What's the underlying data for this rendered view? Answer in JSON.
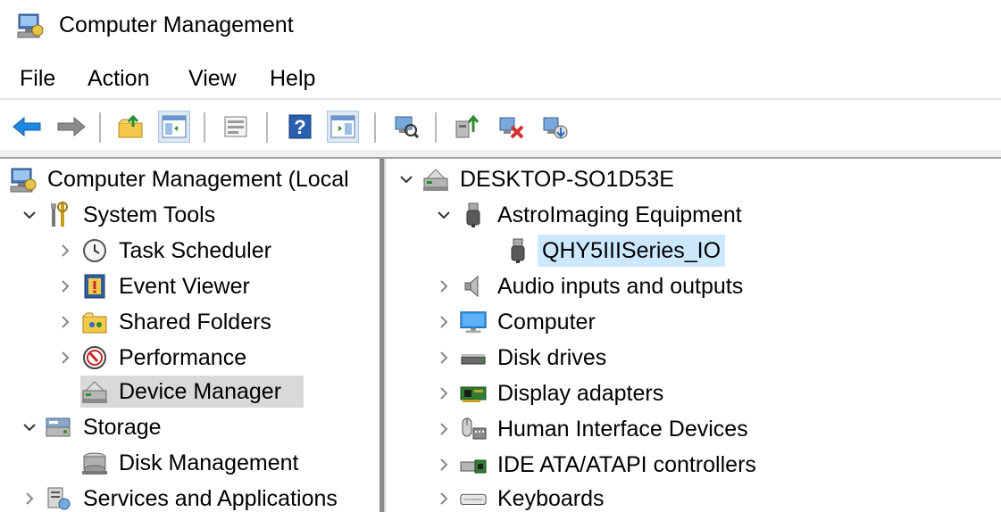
{
  "window": {
    "title": "Computer Management",
    "icon": "computer-management-icon"
  },
  "menu": [
    "File",
    "Action",
    "View",
    "Help"
  ],
  "toolbar": {
    "buttons": [
      "back-arrow-icon",
      "forward-arrow-icon",
      "up-folder-icon",
      "show-hide-console-tree-icon",
      "properties-icon",
      "help-icon",
      "show-hide-action-pane-icon",
      "scan-hardware-icon",
      "update-driver-icon",
      "disable-device-icon",
      "uninstall-device-icon"
    ]
  },
  "left_tree": {
    "root": {
      "label": "Computer Management (Local",
      "icon": "computer-management-icon"
    },
    "system_tools": {
      "label": "System Tools",
      "icon": "tools-icon",
      "children": [
        {
          "label": "Task Scheduler",
          "icon": "clock-icon"
        },
        {
          "label": "Event Viewer",
          "icon": "event-viewer-icon"
        },
        {
          "label": "Shared Folders",
          "icon": "shared-folders-icon"
        },
        {
          "label": "Performance",
          "icon": "performance-icon"
        },
        {
          "label": "Device Manager",
          "icon": "device-manager-icon",
          "selected": true
        }
      ]
    },
    "storage": {
      "label": "Storage",
      "icon": "storage-icon",
      "children": [
        {
          "label": "Disk Management",
          "icon": "disk-management-icon"
        }
      ]
    },
    "services": {
      "label": "Services and Applications",
      "icon": "services-icon"
    }
  },
  "right_tree": {
    "root": {
      "label": "DESKTOP-SO1D53E",
      "icon": "desktop-computer-icon"
    },
    "astro": {
      "label": "AstroImaging Equipment",
      "icon": "usb-device-icon",
      "children": [
        {
          "label": "QHY5IIISeries_IO",
          "icon": "usb-device-icon",
          "highlighted": true
        }
      ]
    },
    "categories": [
      {
        "label": "Audio inputs and outputs",
        "icon": "speaker-icon"
      },
      {
        "label": "Computer",
        "icon": "monitor-icon"
      },
      {
        "label": "Disk drives",
        "icon": "disk-drive-icon"
      },
      {
        "label": "Display adapters",
        "icon": "display-adapter-icon"
      },
      {
        "label": "Human Interface Devices",
        "icon": "hid-icon"
      },
      {
        "label": "IDE ATA/ATAPI controllers",
        "icon": "ide-controller-icon"
      },
      {
        "label": "Keyboards",
        "icon": "keyboard-icon"
      }
    ]
  },
  "colors": {
    "selected_bg": "#d9d9d9",
    "highlight_bg": "#cce8ff",
    "back_arrow": "#1e88e5"
  }
}
